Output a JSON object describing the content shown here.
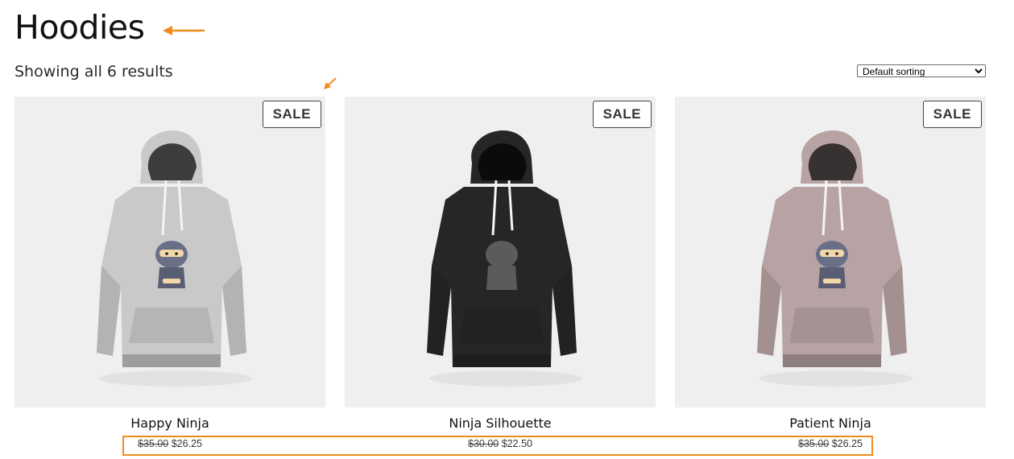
{
  "page": {
    "title": "Hoodies",
    "result_count": "Showing all 6 results"
  },
  "sorting": {
    "selected": "Default sorting",
    "options": [
      "Default sorting"
    ]
  },
  "annotation_color": "#f08c1e",
  "products": [
    {
      "name": "Happy Ninja",
      "badge": "SALE",
      "regular_price": "$35.00",
      "sale_price": "$26.25",
      "hoodie_color": "#c9c9c9",
      "graphic": "ninja"
    },
    {
      "name": "Ninja Silhouette",
      "badge": "SALE",
      "regular_price": "$30.00",
      "sale_price": "$22.50",
      "hoodie_color": "#262626",
      "graphic": "silhouette"
    },
    {
      "name": "Patient Ninja",
      "badge": "SALE",
      "regular_price": "$35.00",
      "sale_price": "$26.25",
      "hoodie_color": "#b7a3a4",
      "graphic": "ninja"
    }
  ]
}
